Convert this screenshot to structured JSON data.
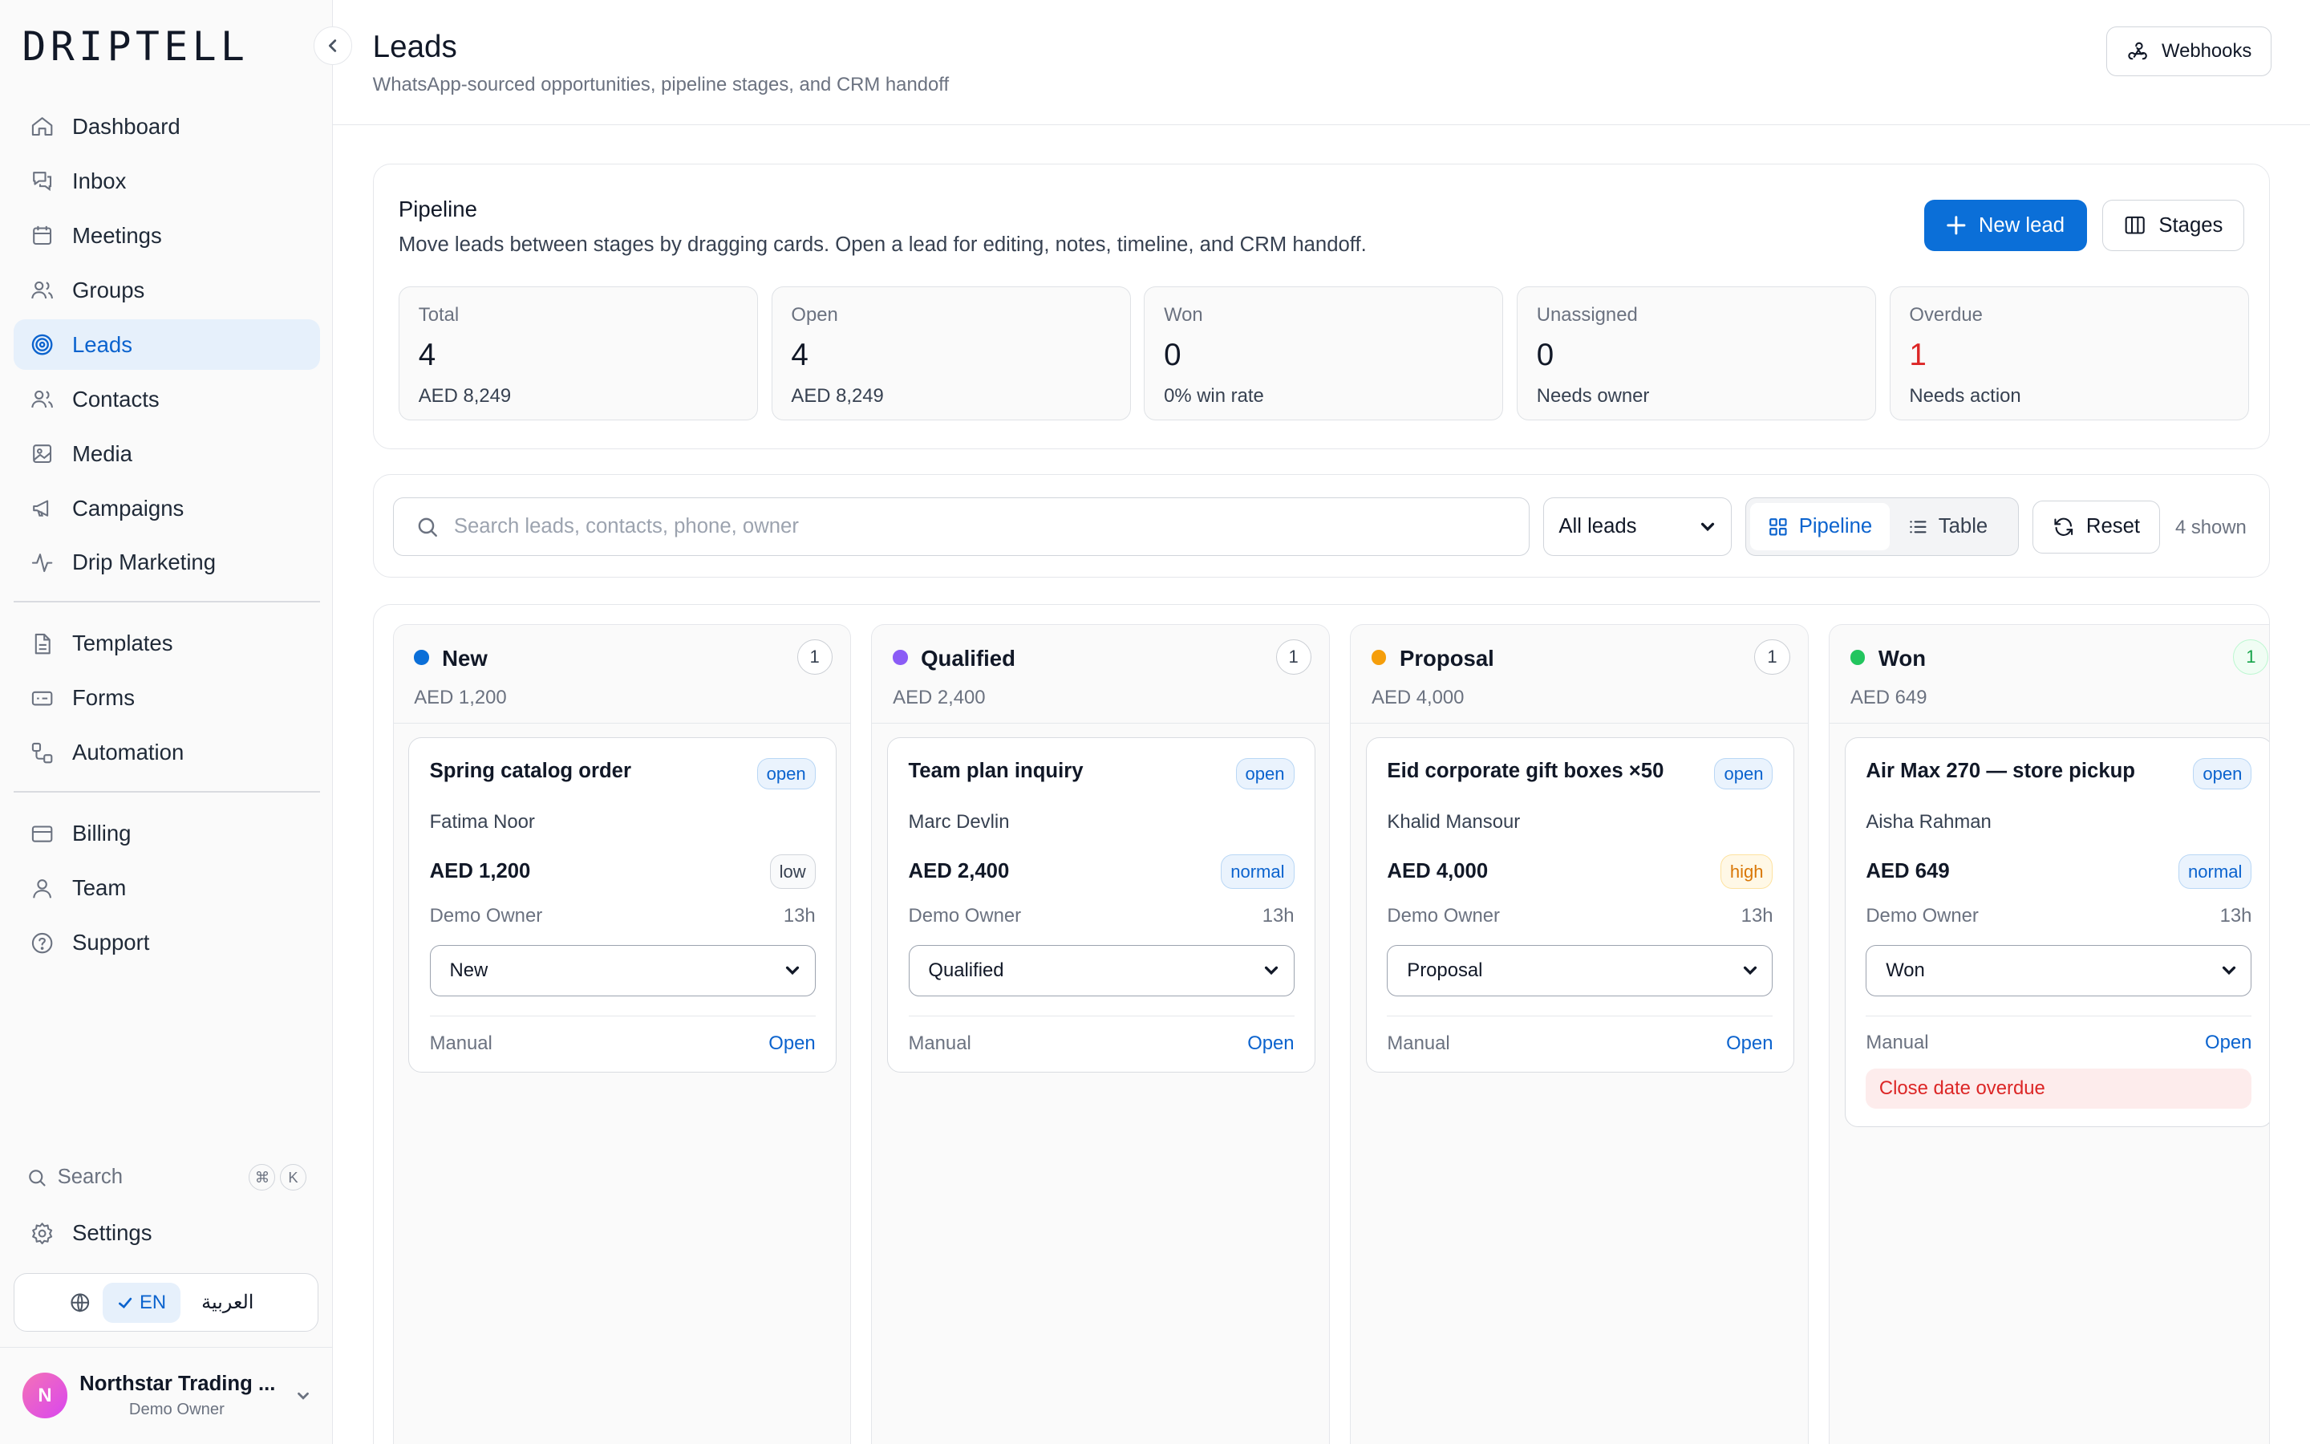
{
  "app": {
    "logo": "DRIPTELL"
  },
  "sidebar": {
    "items": [
      {
        "label": "Dashboard",
        "icon": "home-icon"
      },
      {
        "label": "Inbox",
        "icon": "inbox-icon"
      },
      {
        "label": "Meetings",
        "icon": "calendar-icon"
      },
      {
        "label": "Groups",
        "icon": "users-icon"
      },
      {
        "label": "Leads",
        "icon": "target-icon",
        "active": true
      },
      {
        "label": "Contacts",
        "icon": "contacts-icon"
      },
      {
        "label": "Media",
        "icon": "image-icon"
      },
      {
        "label": "Campaigns",
        "icon": "megaphone-icon"
      },
      {
        "label": "Drip Marketing",
        "icon": "activity-icon"
      },
      {
        "label": "Templates",
        "icon": "file-icon"
      },
      {
        "label": "Forms",
        "icon": "form-icon"
      },
      {
        "label": "Automation",
        "icon": "workflow-icon"
      },
      {
        "label": "Billing",
        "icon": "card-icon"
      },
      {
        "label": "Team",
        "icon": "user-icon"
      },
      {
        "label": "Support",
        "icon": "help-icon"
      }
    ],
    "search_label": "Search",
    "search_keys": [
      "⌘",
      "K"
    ],
    "settings_label": "Settings",
    "lang_en": "EN",
    "lang_ar": "العربية",
    "user_initial": "N",
    "user_name": "Northstar Trading ...",
    "user_role": "Demo Owner"
  },
  "header": {
    "title": "Leads",
    "subtitle": "WhatsApp-sourced opportunities, pipeline stages, and CRM handoff",
    "webhooks_label": "Webhooks"
  },
  "pipeline": {
    "title": "Pipeline",
    "description": "Move leads between stages by dragging cards. Open a lead for editing, notes, timeline, and CRM handoff.",
    "new_lead_label": "New lead",
    "stages_label": "Stages",
    "stats": [
      {
        "label": "Total",
        "value": "4",
        "sub": "AED 8,249"
      },
      {
        "label": "Open",
        "value": "4",
        "sub": "AED 8,249"
      },
      {
        "label": "Won",
        "value": "0",
        "sub": "0% win rate"
      },
      {
        "label": "Unassigned",
        "value": "0",
        "sub": "Needs owner"
      },
      {
        "label": "Overdue",
        "value": "1",
        "sub": "Needs action"
      }
    ]
  },
  "filters": {
    "search_placeholder": "Search leads, contacts, phone, owner",
    "scope": "All leads",
    "view_pipeline": "Pipeline",
    "view_table": "Table",
    "reset_label": "Reset",
    "shown": "4 shown"
  },
  "colors": {
    "accent": "#0b6fd8",
    "new": "#0b6fd8",
    "qualified": "#8b5cf6",
    "proposal": "#f59e0b",
    "won": "#22c55e",
    "danger": "#dc2626"
  },
  "columns": [
    {
      "name": "New",
      "count": "1",
      "total": "AED 1,200",
      "card": {
        "title": "Spring catalog order",
        "status": "open",
        "contact": "Fatima Noor",
        "amount": "AED 1,200",
        "priority": "low",
        "owner": "Demo Owner",
        "age": "13h",
        "stage": "New",
        "source": "Manual",
        "open_label": "Open"
      }
    },
    {
      "name": "Qualified",
      "count": "1",
      "total": "AED 2,400",
      "card": {
        "title": "Team plan inquiry",
        "status": "open",
        "contact": "Marc Devlin",
        "amount": "AED 2,400",
        "priority": "normal",
        "owner": "Demo Owner",
        "age": "13h",
        "stage": "Qualified",
        "source": "Manual",
        "open_label": "Open"
      }
    },
    {
      "name": "Proposal",
      "count": "1",
      "total": "AED 4,000",
      "card": {
        "title": "Eid corporate gift boxes ×50",
        "status": "open",
        "contact": "Khalid Mansour",
        "amount": "AED 4,000",
        "priority": "high",
        "owner": "Demo Owner",
        "age": "13h",
        "stage": "Proposal",
        "source": "Manual",
        "open_label": "Open"
      }
    },
    {
      "name": "Won",
      "count": "1",
      "total": "AED 649",
      "card": {
        "title": "Air Max 270 — store pickup",
        "status": "open",
        "contact": "Aisha Rahman",
        "amount": "AED 649",
        "priority": "normal",
        "owner": "Demo Owner",
        "age": "13h",
        "stage": "Won",
        "source": "Manual",
        "open_label": "Open",
        "alert": "Close date overdue"
      }
    }
  ]
}
